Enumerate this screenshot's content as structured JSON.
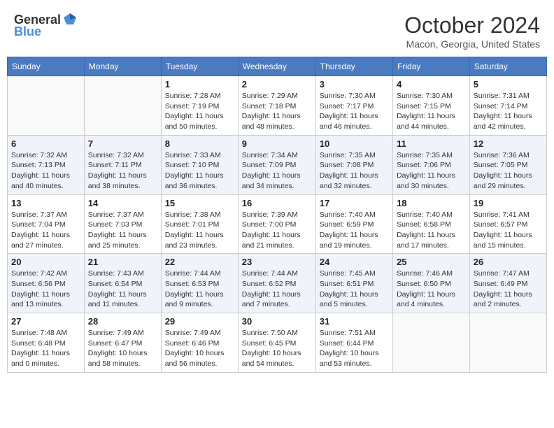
{
  "header": {
    "logo_general": "General",
    "logo_blue": "Blue",
    "month_title": "October 2024",
    "location": "Macon, Georgia, United States"
  },
  "days_of_week": [
    "Sunday",
    "Monday",
    "Tuesday",
    "Wednesday",
    "Thursday",
    "Friday",
    "Saturday"
  ],
  "weeks": [
    [
      {
        "day": "",
        "info": ""
      },
      {
        "day": "",
        "info": ""
      },
      {
        "day": "1",
        "sunrise": "Sunrise: 7:28 AM",
        "sunset": "Sunset: 7:19 PM",
        "daylight": "Daylight: 11 hours and 50 minutes."
      },
      {
        "day": "2",
        "sunrise": "Sunrise: 7:29 AM",
        "sunset": "Sunset: 7:18 PM",
        "daylight": "Daylight: 11 hours and 48 minutes."
      },
      {
        "day": "3",
        "sunrise": "Sunrise: 7:30 AM",
        "sunset": "Sunset: 7:17 PM",
        "daylight": "Daylight: 11 hours and 46 minutes."
      },
      {
        "day": "4",
        "sunrise": "Sunrise: 7:30 AM",
        "sunset": "Sunset: 7:15 PM",
        "daylight": "Daylight: 11 hours and 44 minutes."
      },
      {
        "day": "5",
        "sunrise": "Sunrise: 7:31 AM",
        "sunset": "Sunset: 7:14 PM",
        "daylight": "Daylight: 11 hours and 42 minutes."
      }
    ],
    [
      {
        "day": "6",
        "sunrise": "Sunrise: 7:32 AM",
        "sunset": "Sunset: 7:13 PM",
        "daylight": "Daylight: 11 hours and 40 minutes."
      },
      {
        "day": "7",
        "sunrise": "Sunrise: 7:32 AM",
        "sunset": "Sunset: 7:11 PM",
        "daylight": "Daylight: 11 hours and 38 minutes."
      },
      {
        "day": "8",
        "sunrise": "Sunrise: 7:33 AM",
        "sunset": "Sunset: 7:10 PM",
        "daylight": "Daylight: 11 hours and 36 minutes."
      },
      {
        "day": "9",
        "sunrise": "Sunrise: 7:34 AM",
        "sunset": "Sunset: 7:09 PM",
        "daylight": "Daylight: 11 hours and 34 minutes."
      },
      {
        "day": "10",
        "sunrise": "Sunrise: 7:35 AM",
        "sunset": "Sunset: 7:08 PM",
        "daylight": "Daylight: 11 hours and 32 minutes."
      },
      {
        "day": "11",
        "sunrise": "Sunrise: 7:35 AM",
        "sunset": "Sunset: 7:06 PM",
        "daylight": "Daylight: 11 hours and 30 minutes."
      },
      {
        "day": "12",
        "sunrise": "Sunrise: 7:36 AM",
        "sunset": "Sunset: 7:05 PM",
        "daylight": "Daylight: 11 hours and 29 minutes."
      }
    ],
    [
      {
        "day": "13",
        "sunrise": "Sunrise: 7:37 AM",
        "sunset": "Sunset: 7:04 PM",
        "daylight": "Daylight: 11 hours and 27 minutes."
      },
      {
        "day": "14",
        "sunrise": "Sunrise: 7:37 AM",
        "sunset": "Sunset: 7:03 PM",
        "daylight": "Daylight: 11 hours and 25 minutes."
      },
      {
        "day": "15",
        "sunrise": "Sunrise: 7:38 AM",
        "sunset": "Sunset: 7:01 PM",
        "daylight": "Daylight: 11 hours and 23 minutes."
      },
      {
        "day": "16",
        "sunrise": "Sunrise: 7:39 AM",
        "sunset": "Sunset: 7:00 PM",
        "daylight": "Daylight: 11 hours and 21 minutes."
      },
      {
        "day": "17",
        "sunrise": "Sunrise: 7:40 AM",
        "sunset": "Sunset: 6:59 PM",
        "daylight": "Daylight: 11 hours and 19 minutes."
      },
      {
        "day": "18",
        "sunrise": "Sunrise: 7:40 AM",
        "sunset": "Sunset: 6:58 PM",
        "daylight": "Daylight: 11 hours and 17 minutes."
      },
      {
        "day": "19",
        "sunrise": "Sunrise: 7:41 AM",
        "sunset": "Sunset: 6:57 PM",
        "daylight": "Daylight: 11 hours and 15 minutes."
      }
    ],
    [
      {
        "day": "20",
        "sunrise": "Sunrise: 7:42 AM",
        "sunset": "Sunset: 6:56 PM",
        "daylight": "Daylight: 11 hours and 13 minutes."
      },
      {
        "day": "21",
        "sunrise": "Sunrise: 7:43 AM",
        "sunset": "Sunset: 6:54 PM",
        "daylight": "Daylight: 11 hours and 11 minutes."
      },
      {
        "day": "22",
        "sunrise": "Sunrise: 7:44 AM",
        "sunset": "Sunset: 6:53 PM",
        "daylight": "Daylight: 11 hours and 9 minutes."
      },
      {
        "day": "23",
        "sunrise": "Sunrise: 7:44 AM",
        "sunset": "Sunset: 6:52 PM",
        "daylight": "Daylight: 11 hours and 7 minutes."
      },
      {
        "day": "24",
        "sunrise": "Sunrise: 7:45 AM",
        "sunset": "Sunset: 6:51 PM",
        "daylight": "Daylight: 11 hours and 5 minutes."
      },
      {
        "day": "25",
        "sunrise": "Sunrise: 7:46 AM",
        "sunset": "Sunset: 6:50 PM",
        "daylight": "Daylight: 11 hours and 4 minutes."
      },
      {
        "day": "26",
        "sunrise": "Sunrise: 7:47 AM",
        "sunset": "Sunset: 6:49 PM",
        "daylight": "Daylight: 11 hours and 2 minutes."
      }
    ],
    [
      {
        "day": "27",
        "sunrise": "Sunrise: 7:48 AM",
        "sunset": "Sunset: 6:48 PM",
        "daylight": "Daylight: 11 hours and 0 minutes."
      },
      {
        "day": "28",
        "sunrise": "Sunrise: 7:49 AM",
        "sunset": "Sunset: 6:47 PM",
        "daylight": "Daylight: 10 hours and 58 minutes."
      },
      {
        "day": "29",
        "sunrise": "Sunrise: 7:49 AM",
        "sunset": "Sunset: 6:46 PM",
        "daylight": "Daylight: 10 hours and 56 minutes."
      },
      {
        "day": "30",
        "sunrise": "Sunrise: 7:50 AM",
        "sunset": "Sunset: 6:45 PM",
        "daylight": "Daylight: 10 hours and 54 minutes."
      },
      {
        "day": "31",
        "sunrise": "Sunrise: 7:51 AM",
        "sunset": "Sunset: 6:44 PM",
        "daylight": "Daylight: 10 hours and 53 minutes."
      },
      {
        "day": "",
        "info": ""
      },
      {
        "day": "",
        "info": ""
      }
    ]
  ]
}
